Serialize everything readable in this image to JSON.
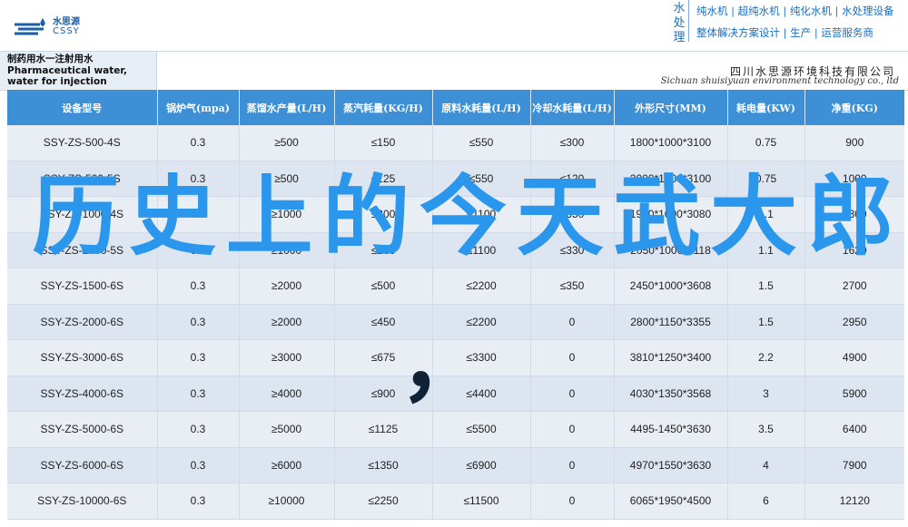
{
  "brand": {
    "name_cn": "水思源",
    "name_en": "CSSY"
  },
  "right_tagline": {
    "tag": "水处理",
    "line1": "纯水机 | 超纯水机 | 纯化水机 | 水处理设备",
    "line2": "整体解决方案设计 | 生产 | 运营服务商"
  },
  "doc": {
    "left_title": "制药用水一注射用水 Pharmaceutical water, water for injection",
    "company_cn": "四川水思源环境科技有限公司",
    "company_en": "Sichuan shuisiyuan environment technology co., ltd"
  },
  "table": {
    "headers": [
      "设备型号",
      "锅炉气(mpa)",
      "蒸馏水产量(L/H)",
      "蒸汽耗量(KG/H)",
      "原料水耗量(L/H)",
      "冷却水耗量(L/H)",
      "外形尺寸(MM)",
      "耗电量(KW)",
      "净重(KG)"
    ],
    "rows": [
      [
        "SSY-ZS-500-4S",
        "0.3",
        "≥500",
        "≤150",
        "≤550",
        "≤300",
        "1800*1000*3100",
        "0.75",
        "900"
      ],
      [
        "SSY-ZS-500-5S",
        "0.3",
        "≥500",
        "≤125",
        "≤550",
        "≤120",
        "2000*1000*3100",
        "0.75",
        "1000"
      ],
      [
        "SSY-ZS-1000-4S",
        "0.3",
        "≥1000",
        "≤300",
        "≤1100",
        "≤650",
        "1930*1000*3080",
        "1.1",
        "1300"
      ],
      [
        "SSY-ZS-1000-5S",
        "0.3",
        "≥1000",
        "≤260",
        "≤1100",
        "≤330",
        "2050*1000*3118",
        "1.1",
        "1620"
      ],
      [
        "SSY-ZS-1500-6S",
        "0.3",
        "≥2000",
        "≤500",
        "≤2200",
        "≤350",
        "2450*1000*3608",
        "1.5",
        "2700"
      ],
      [
        "SSY-ZS-2000-6S",
        "0.3",
        "≥2000",
        "≤450",
        "≤2200",
        "0",
        "2800*1150*3355",
        "1.5",
        "2950"
      ],
      [
        "SSY-ZS-3000-6S",
        "0.3",
        "≥3000",
        "≤675",
        "≤3300",
        "0",
        "3810*1250*3400",
        "2.2",
        "4900"
      ],
      [
        "SSY-ZS-4000-6S",
        "0.3",
        "≥4000",
        "≤900",
        "≤4400",
        "0",
        "4030*1350*3568",
        "3",
        "5900"
      ],
      [
        "SSY-ZS-5000-6S",
        "0.3",
        "≥5000",
        "≤1125",
        "≤5500",
        "0",
        "4495-1450*3630",
        "3.5",
        "6400"
      ],
      [
        "SSY-ZS-6000-6S",
        "0.3",
        "≥6000",
        "≤1350",
        "≤6900",
        "0",
        "4970*1550*3630",
        "4",
        "7900"
      ],
      [
        "SSY-ZS-10000-6S",
        "0.3",
        "≥10000",
        "≤2250",
        "≤11500",
        "0",
        "6065*1950*4500",
        "6",
        "12120"
      ]
    ]
  },
  "overlay": {
    "chars": [
      "历",
      "史",
      "上",
      "的",
      "今",
      "天",
      "武",
      "大",
      "郎"
    ],
    "comma": "，"
  },
  "colors": {
    "header_blue": "#3d8fd6",
    "overlay_blue": "#2a97ec",
    "brand_blue": "#1a5ea8"
  }
}
